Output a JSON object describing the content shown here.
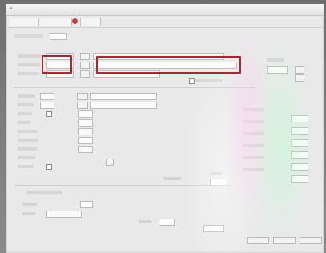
{
  "highlights": {
    "color": "#b3242a"
  }
}
